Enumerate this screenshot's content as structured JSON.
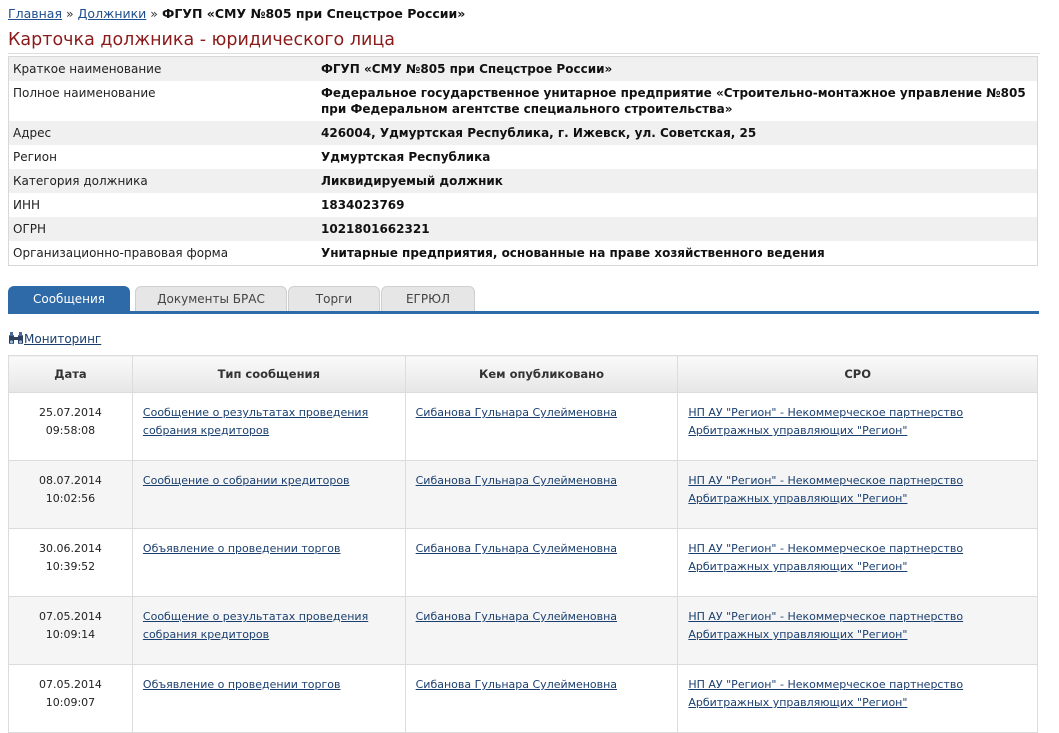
{
  "breadcrumb": {
    "home": "Главная",
    "debtors": "Должники",
    "separator": "»",
    "current": "ФГУП «СМУ №805 при Спецстрое России»"
  },
  "page_title": "Карточка должника - юридического лица",
  "info_rows": [
    {
      "label": "Краткое наименование",
      "value": "ФГУП «СМУ №805 при Спецстрое России»"
    },
    {
      "label": "Полное наименование",
      "value": "Федеральное государственное унитарное предприятие «Строительно-монтажное управление №805 при Федеральном агентстве специального строительства»"
    },
    {
      "label": "Адрес",
      "value": "426004, Удмуртская Республика, г. Ижевск, ул. Советская, 25"
    },
    {
      "label": "Регион",
      "value": "Удмуртская Республика"
    },
    {
      "label": "Категория должника",
      "value": "Ликвидируемый должник"
    },
    {
      "label": "ИНН",
      "value": "1834023769"
    },
    {
      "label": "ОГРН",
      "value": "1021801662321"
    },
    {
      "label": "Организационно-правовая форма",
      "value": "Унитарные предприятия, основанные на праве хозяйственного ведения"
    }
  ],
  "tabs": [
    "Сообщения",
    "Документы БРАС",
    "Торги",
    "ЕГРЮЛ"
  ],
  "monitoring": {
    "label": "Мониторинг",
    "icon": "binoculars-icon"
  },
  "table": {
    "headers": [
      "Дата",
      "Тип сообщения",
      "Кем опубликовано",
      "СРО"
    ],
    "rows": [
      {
        "date": "25.07.2014 09:58:08",
        "type": "Сообщение о результатах проведения собрания кредиторов",
        "publisher": "Сибанова Гульнара Сулейменовна",
        "sro": "НП АУ \"Регион\" - Некоммерческое партнерство Арбитражных управляющих \"Регион\""
      },
      {
        "date": "08.07.2014 10:02:56",
        "type": "Сообщение о собрании кредиторов",
        "publisher": "Сибанова Гульнара Сулейменовна",
        "sro": "НП АУ \"Регион\" - Некоммерческое партнерство Арбитражных управляющих \"Регион\""
      },
      {
        "date": "30.06.2014 10:39:52",
        "type": "Объявление о проведении торгов",
        "publisher": "Сибанова Гульнара Сулейменовна",
        "sro": "НП АУ \"Регион\" - Некоммерческое партнерство Арбитражных управляющих \"Регион\""
      },
      {
        "date": "07.05.2014 10:09:14",
        "type": "Сообщение о результатах проведения собрания кредиторов",
        "publisher": "Сибанова Гульнара Сулейменовна",
        "sro": "НП АУ \"Регион\" - Некоммерческое партнерство Арбитражных управляющих \"Регион\""
      },
      {
        "date": "07.05.2014 10:09:07",
        "type": "Объявление о проведении торгов",
        "publisher": "Сибанова Гульнара Сулейменовна",
        "sro": "НП АУ \"Регион\" - Некоммерческое партнерство Арбитражных управляющих \"Регион\""
      }
    ]
  },
  "colors": {
    "title": "#8b1a1a",
    "tab_active": "#2f6aa8",
    "link": "#1a3f6f"
  }
}
